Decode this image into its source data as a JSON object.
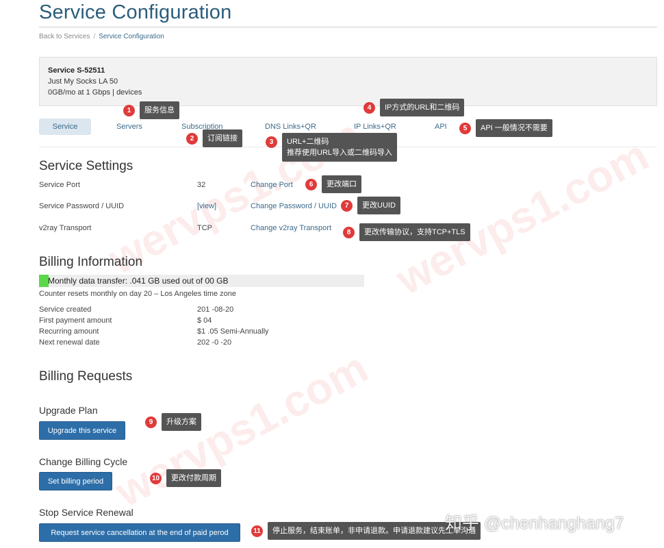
{
  "page": {
    "title": "Service Configuration",
    "breadcrumb": [
      "Back to Services",
      "Service Configuration"
    ]
  },
  "service": {
    "name": "Service S-52511",
    "plan": "Just My Socks LA  50",
    "detail": "  0GB/mo at 1 Gbps |  devices"
  },
  "tabs": [
    "Service",
    "Servers",
    "Subscription",
    "DNS Links+QR",
    "IP Links+QR",
    "API"
  ],
  "service_settings": {
    "title": "Service Settings",
    "rows": [
      {
        "label": "Service Port",
        "value": "  32",
        "action": "Change Port"
      },
      {
        "label": "Service Password / UUID",
        "value": "[view]",
        "action": "Change Password / UUID"
      },
      {
        "label": "v2ray Transport",
        "value": "TCP",
        "action": "Change v2ray Transport"
      }
    ]
  },
  "billing_info": {
    "title": "Billing Information",
    "usage_text": "Monthly data transfer:  .041 GB used out of  00 GB",
    "usage_fraction": 0.03,
    "reset_note": "Counter resets monthly on day 20 – Los Angeles time zone",
    "rows": [
      {
        "label": "Service created",
        "value": "201 -08-20"
      },
      {
        "label": "First payment amount",
        "value": "$  04"
      },
      {
        "label": "Recurring amount",
        "value": "$1 .05 Semi-Annually"
      },
      {
        "label": "Next renewal date",
        "value": "202 -0 -20"
      }
    ]
  },
  "billing_requests": {
    "title": "Billing Requests",
    "upgrade_title": "Upgrade Plan",
    "upgrade_button": "Upgrade this service",
    "cycle_title": "Change Billing Cycle",
    "cycle_button": "Set billing period",
    "stop_title": "Stop Service Renewal",
    "stop_button": "Request service cancellation at the end of paid perod"
  },
  "annotations": [
    {
      "num": "1",
      "text": "服务信息"
    },
    {
      "num": "2",
      "text": "订阅链接"
    },
    {
      "num": "3",
      "text": "URL+二维码",
      "text2": "推荐使用URL导入或二维码导入"
    },
    {
      "num": "4",
      "text": "IP方式的URL和二维码"
    },
    {
      "num": "5",
      "text": "API 一般情况不需要"
    },
    {
      "num": "6",
      "text": "更改端口"
    },
    {
      "num": "7",
      "text": "更改UUID"
    },
    {
      "num": "8",
      "text": "更改传输协议，支持TCP+TLS"
    },
    {
      "num": "9",
      "text": "升级方案"
    },
    {
      "num": "10",
      "text": "更改付款周期"
    },
    {
      "num": "11",
      "text": "停止服务，结束账单，非申请退款。申请退款建议先工单沟通"
    }
  ],
  "watermark": "wervps1.com",
  "footer_mark": "知乎 @chenhanghang7",
  "colors": {
    "title": "#2a5d7c",
    "link": "#3a6a8a",
    "button": "#2d6ea8",
    "progress": "#5bd84a",
    "badge": "#e03a3a",
    "callout": "#545454"
  }
}
